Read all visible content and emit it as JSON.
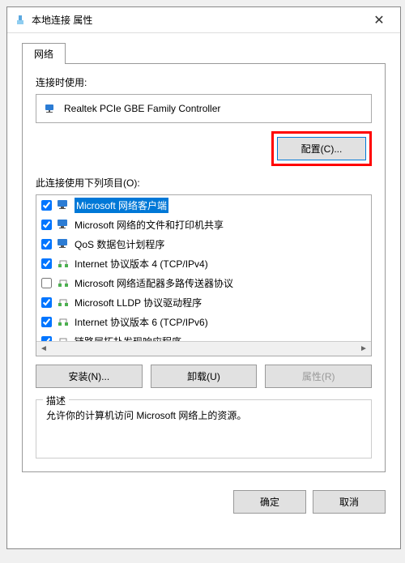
{
  "titlebar": {
    "title": "本地连接 属性"
  },
  "tab": {
    "network": "网络"
  },
  "labels": {
    "connect_using": "连接时使用:",
    "this_connection_uses": "此连接使用下列项目(O):"
  },
  "adapter": {
    "name": "Realtek PCIe GBE Family Controller"
  },
  "buttons": {
    "configure": "配置(C)...",
    "install": "安装(N)...",
    "uninstall": "卸载(U)",
    "properties": "属性(R)",
    "ok": "确定",
    "cancel": "取消"
  },
  "components": [
    {
      "checked": true,
      "icon": "monitor",
      "label": "Microsoft 网络客户端",
      "selected": true
    },
    {
      "checked": true,
      "icon": "monitor",
      "label": "Microsoft 网络的文件和打印机共享",
      "selected": false
    },
    {
      "checked": true,
      "icon": "monitor",
      "label": "QoS 数据包计划程序",
      "selected": false
    },
    {
      "checked": true,
      "icon": "protocol",
      "label": "Internet 协议版本 4 (TCP/IPv4)",
      "selected": false
    },
    {
      "checked": false,
      "icon": "protocol",
      "label": "Microsoft 网络适配器多路传送器协议",
      "selected": false
    },
    {
      "checked": true,
      "icon": "protocol",
      "label": "Microsoft LLDP 协议驱动程序",
      "selected": false
    },
    {
      "checked": true,
      "icon": "protocol",
      "label": "Internet 协议版本 6 (TCP/IPv6)",
      "selected": false
    },
    {
      "checked": true,
      "icon": "protocol",
      "label": "链路层拓扑发现响应程序",
      "selected": false
    }
  ],
  "description": {
    "legend": "描述",
    "text": "允许你的计算机访问 Microsoft 网络上的资源。"
  }
}
